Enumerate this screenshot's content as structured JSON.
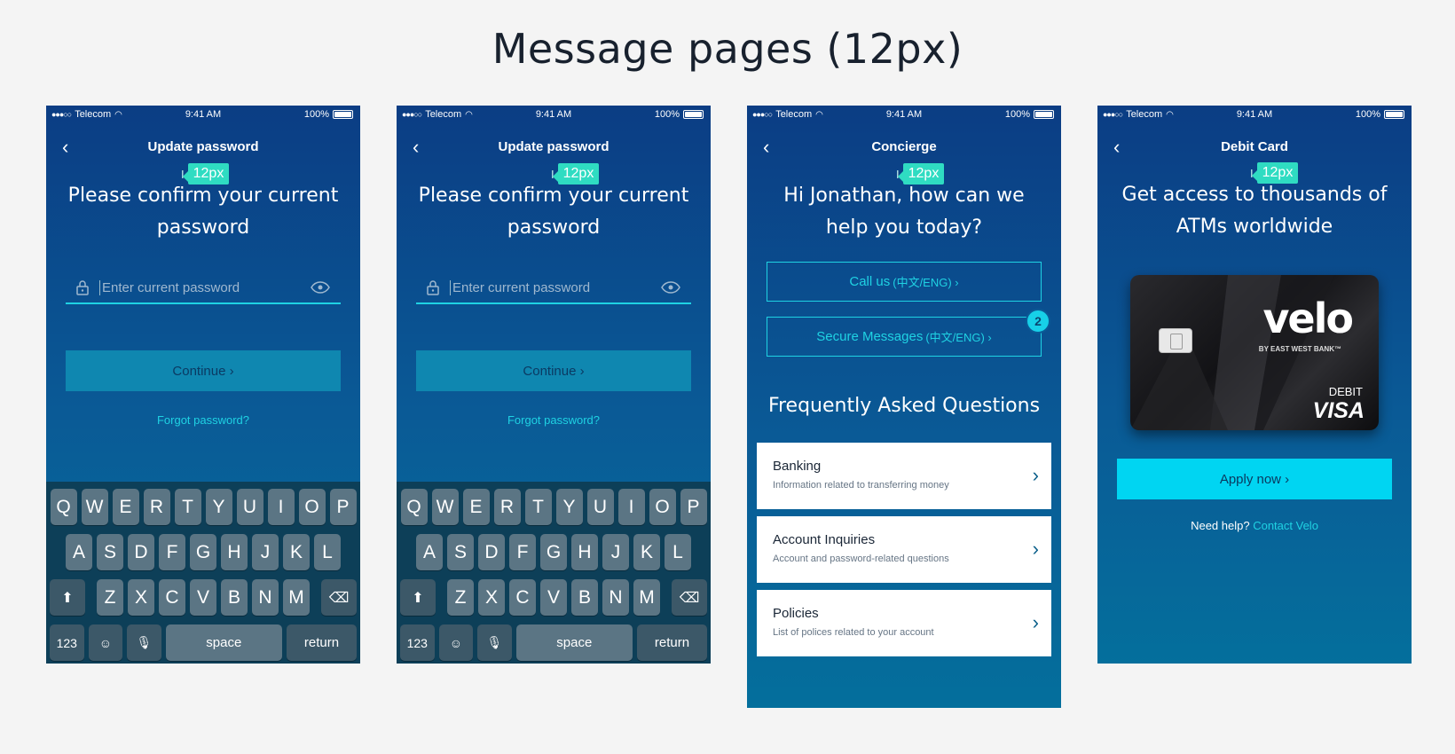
{
  "page_title": "Message pages (12px)",
  "status": {
    "carrier": "Telecom",
    "time": "9:41 AM",
    "battery": "100%"
  },
  "marker_label": "12px",
  "screen1": {
    "title": "Update password",
    "heading": "Please confirm your current password",
    "password_placeholder": "Enter current password",
    "continue_label": "Continue ›",
    "forgot_label": "Forgot password?"
  },
  "screen2": {
    "title": "Update password",
    "heading": "Please confirm your current password",
    "password_placeholder": "Enter current password",
    "continue_label": "Continue ›",
    "forgot_label": "Forgot password?"
  },
  "keyboard": {
    "row1": [
      "Q",
      "W",
      "E",
      "R",
      "T",
      "Y",
      "U",
      "I",
      "O",
      "P"
    ],
    "row2": [
      "A",
      "S",
      "D",
      "F",
      "G",
      "H",
      "J",
      "K",
      "L"
    ],
    "row3": [
      "Z",
      "X",
      "C",
      "V",
      "B",
      "N",
      "M"
    ],
    "num_label": "123",
    "space_label": "space",
    "return_label": "return"
  },
  "screen3": {
    "title": "Concierge",
    "heading": "Hi Jonathan, how can we help you today?",
    "call_label": "Call us",
    "call_lang": "(中文/ENG) ›",
    "secure_label": "Secure Messages",
    "secure_lang": "(中文/ENG) ›",
    "secure_badge": "2",
    "faq_title": "Frequently Asked Questions",
    "faq": [
      {
        "title": "Banking",
        "desc": "Information related to transferring money"
      },
      {
        "title": "Account Inquiries",
        "desc": "Account and password-related questions"
      },
      {
        "title": "Policies",
        "desc": "List of polices related to your account"
      }
    ]
  },
  "screen4": {
    "title": "Debit Card",
    "heading": "Get access to thousands of ATMs worldwide",
    "card_brand": "velo",
    "card_bank": "BY EAST WEST BANK™",
    "card_type": "DEBIT",
    "card_network": "VISA",
    "apply_label": "Apply now ›",
    "help_text": "Need help?",
    "help_link": "Contact Velo"
  },
  "colors": {
    "accent": "#1fd2e3",
    "marker": "#2fdcc2",
    "bg_top": "#0b3d84",
    "bg_bottom": "#046f9c"
  }
}
